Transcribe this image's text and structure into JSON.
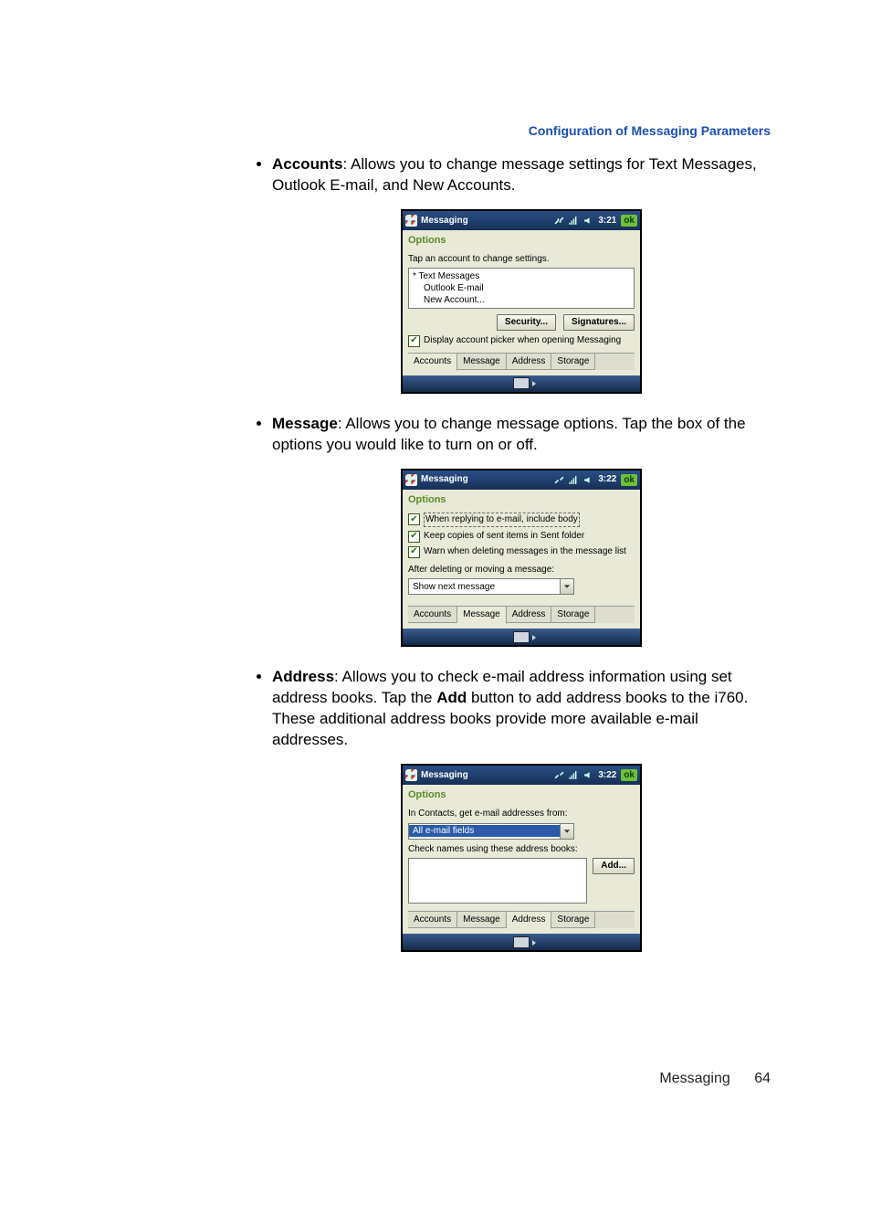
{
  "page": {
    "section_header": "Configuration of Messaging Parameters",
    "footer_label": "Messaging",
    "footer_page": "64"
  },
  "bullets": {
    "accounts": {
      "term": "Accounts",
      "desc": ": Allows you to change message settings for Text Messages, Outlook E-mail, and New Accounts."
    },
    "message": {
      "term": "Message",
      "desc": ": Allows you to change message options. Tap the box of the options you would like to turn on or off."
    },
    "address": {
      "term": "Address",
      "desc_pre": ": Allows you to check e-mail address information using set address books. Tap the ",
      "add_word": "Add",
      "desc_post": " button to add address books to the i760. These additional address books provide more available e-mail addresses."
    }
  },
  "wm": {
    "title": "Messaging",
    "options_label": "Options",
    "ok": "ok",
    "tabs": {
      "accounts": "Accounts",
      "message": "Message",
      "address": "Address",
      "storage": "Storage"
    }
  },
  "shot1": {
    "time": "3:21",
    "hint": "Tap an account to change settings.",
    "items": {
      "a": "Text Messages",
      "b": "Outlook E-mail",
      "c": "New Account..."
    },
    "btn_security": "Security...",
    "btn_signatures": "Signatures...",
    "chk_label": "Display account picker when opening Messaging"
  },
  "shot2": {
    "time": "3:22",
    "chk1": "When replying to e-mail, include body",
    "chk2": "Keep copies of sent items in Sent folder",
    "chk3": "Warn when deleting messages in the message list",
    "after_label": "After deleting or moving a message:",
    "combo_value": "Show next message"
  },
  "shot3": {
    "time": "3:22",
    "line1": "In Contacts, get e-mail addresses from:",
    "combo_value": "All e-mail fields",
    "line2": "Check names using these address books:",
    "btn_add": "Add..."
  }
}
